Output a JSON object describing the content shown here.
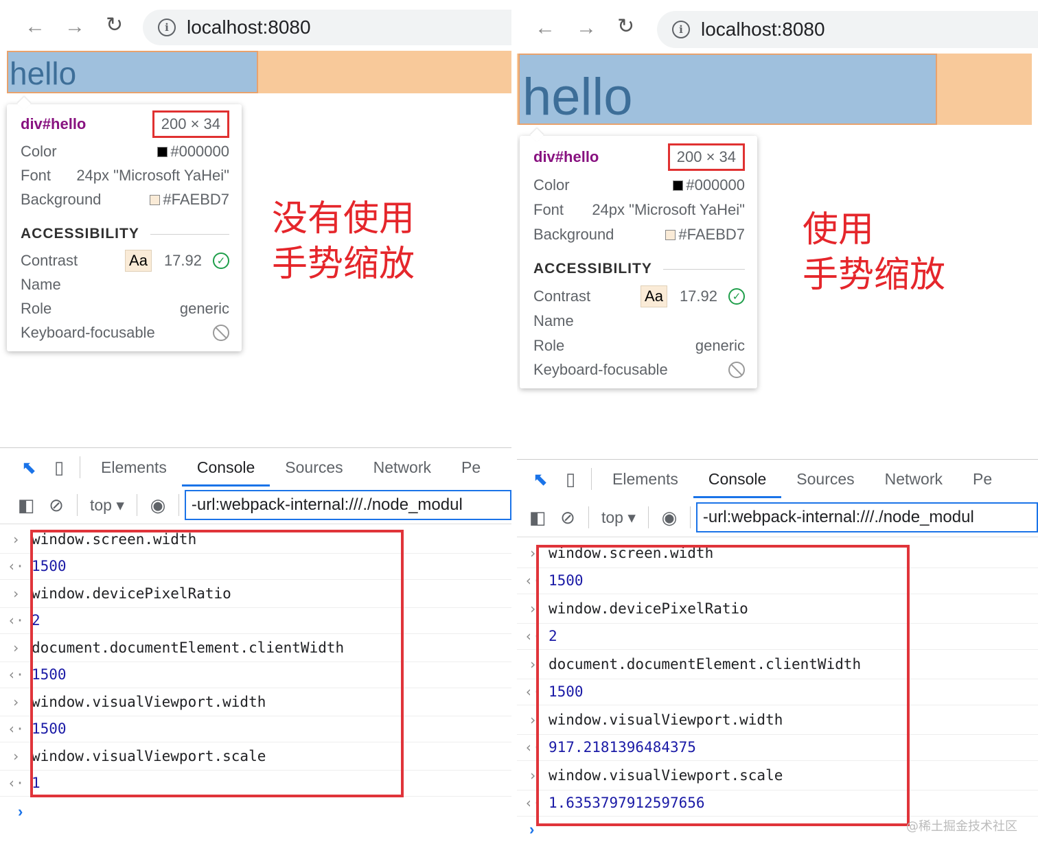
{
  "browser": {
    "back": "←",
    "forward": "→",
    "reload": "↻",
    "url": "localhost:8080"
  },
  "page": {
    "hello_text": "hello"
  },
  "tooltip": {
    "selector_tag": "div",
    "selector_id": "#hello",
    "dimensions": "200 × 34",
    "color_label": "Color",
    "color_value": "#000000",
    "font_label": "Font",
    "font_value": "24px \"Microsoft YaHei\"",
    "background_label": "Background",
    "background_value": "#FAEBD7",
    "accessibility_heading": "ACCESSIBILITY",
    "contrast_label": "Contrast",
    "contrast_sample": "Aa",
    "contrast_value": "17.92",
    "name_label": "Name",
    "role_label": "Role",
    "role_value": "generic",
    "keyboard_label": "Keyboard-focusable"
  },
  "annotations": {
    "left_line1": "没有使用",
    "left_line2": "手势缩放",
    "right_line1": "使用",
    "right_line2": "手势缩放"
  },
  "devtools": {
    "tabs": [
      "Elements",
      "Console",
      "Sources",
      "Network",
      "Pe"
    ],
    "context": "top",
    "filter": "-url:webpack-internal:///./node_modul"
  },
  "console_left": [
    {
      "kind": "in",
      "text": "window.screen.width"
    },
    {
      "kind": "out",
      "text": "1500"
    },
    {
      "kind": "in",
      "text": "window.devicePixelRatio"
    },
    {
      "kind": "out",
      "text": "2"
    },
    {
      "kind": "in",
      "text": "document.documentElement.clientWidth"
    },
    {
      "kind": "out",
      "text": "1500"
    },
    {
      "kind": "in",
      "text": "window.visualViewport.width"
    },
    {
      "kind": "out",
      "text": "1500"
    },
    {
      "kind": "in",
      "text": "window.visualViewport.scale"
    },
    {
      "kind": "out",
      "text": "1"
    }
  ],
  "console_right": [
    {
      "kind": "in",
      "text": "window.screen.width"
    },
    {
      "kind": "out",
      "text": "1500"
    },
    {
      "kind": "in",
      "text": "window.devicePixelRatio"
    },
    {
      "kind": "out",
      "text": "2"
    },
    {
      "kind": "in",
      "text": "document.documentElement.clientWidth"
    },
    {
      "kind": "out",
      "text": "1500"
    },
    {
      "kind": "in",
      "text": "window.visualViewport.width"
    },
    {
      "kind": "out",
      "text": "917.2181396484375"
    },
    {
      "kind": "in",
      "text": "window.visualViewport.scale"
    },
    {
      "kind": "out",
      "text": "1.6353797912597656"
    }
  ],
  "watermark": "@稀土掘金技术社区",
  "colors": {
    "annotation_red": "#e5262b",
    "highlight_blue": "#9fc0dd",
    "highlight_orange": "#f8c99a",
    "accent": "#1a73e8"
  }
}
